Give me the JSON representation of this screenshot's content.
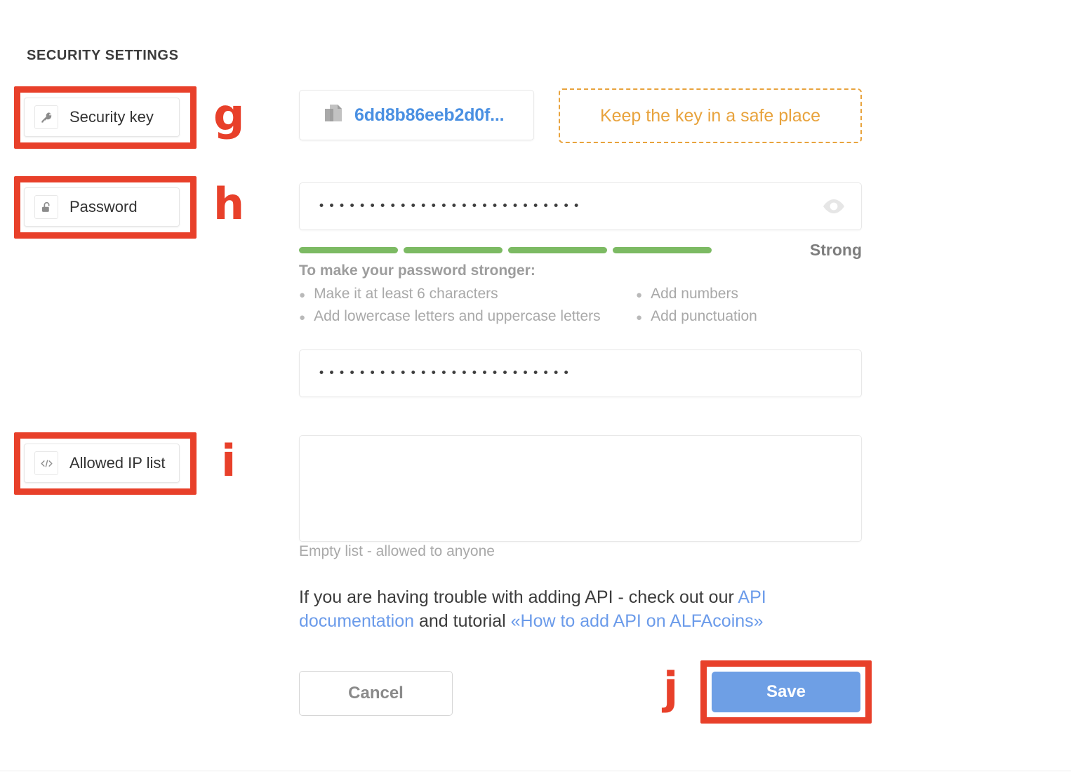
{
  "section": {
    "title": "SECURITY SETTINGS"
  },
  "nav": {
    "items": [
      {
        "label": "Security key",
        "icon": "key-icon",
        "marker": "g"
      },
      {
        "label": "Password",
        "icon": "unlock-icon",
        "marker": "h"
      },
      {
        "label": "Allowed IP list",
        "icon": "code-icon",
        "marker": "i"
      }
    ]
  },
  "security_key": {
    "value": "6dd8b86eeb2d0f...",
    "copy_icon": "copy-icon",
    "notice": "Keep the key in a safe place"
  },
  "password": {
    "value": "••••••••••••••••••••••••••",
    "toggle_icon": "eye-icon",
    "strength_label": "Strong",
    "strength_filled": 4,
    "strength_total": 4,
    "strength_color": "#7cba63",
    "hints_title": "To make your password stronger:",
    "hints_left": [
      "Make it at least 6 characters",
      "Add lowercase letters and uppercase letters"
    ],
    "hints_right": [
      "Add numbers",
      "Add punctuation"
    ]
  },
  "confirm_password": {
    "value": "•••••••••••••••••••••••••"
  },
  "allowed_ip": {
    "value": "",
    "hint": "Empty list - allowed to anyone"
  },
  "api_help": {
    "text_before": "If you are having trouble with adding API - check out our ",
    "link_docs": "API documentation",
    "text_middle": " and tutorial ",
    "link_tutorial": "«How to add API on ALFAcoins»"
  },
  "actions": {
    "cancel_label": "Cancel",
    "save_label": "Save",
    "save_marker": "j"
  },
  "colors": {
    "annotation_red": "#e8402a",
    "link_blue": "#6b9bea",
    "key_blue": "#4a90e2",
    "notice_orange": "#e8a33d",
    "save_blue": "#6e9fe5",
    "strength_green": "#7cba63"
  }
}
